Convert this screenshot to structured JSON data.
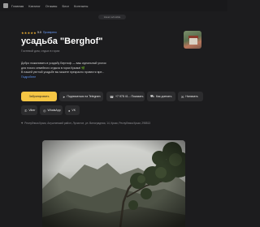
{
  "nav": {
    "links": [
      "Главная",
      "Каталог",
      "Отзывы",
      "Блог",
      "Контакты"
    ]
  },
  "domain_badge": "travel.ru/mobile",
  "profile": {
    "stars": "★★★★★",
    "rating": "5.0",
    "verified_label": "Проверено",
    "title": "усадьба \"Berghof\"",
    "category": "Гостевой дом, отдых в горах"
  },
  "description": {
    "lines": [
      "Добро пожаловать в усадьбу Бергхоф — ваш идеальный уголок",
      "для тихого семейного отдыха в горах Крыма! 🌿",
      "В нашей уютной усадьбе вы можете прекрасно провести вре..."
    ],
    "more_link": "Подробнее"
  },
  "actions": {
    "book": "Забронировать",
    "telegram": "Подписаться на Telegram",
    "phone": "+7 978 41... Показать",
    "route": "Как доехать",
    "write": "Написать",
    "viber": "Viber",
    "whatsapp": "WhatsApp",
    "vk": "VK"
  },
  "icons": {
    "telegram": "paper-plane-icon",
    "phone": "phone-icon",
    "route": "car-icon",
    "write": "message-icon",
    "viber": "viber-icon",
    "whatsapp": "whatsapp-icon",
    "vk": "vk-icon",
    "address": "map-pin-icon"
  },
  "address": "Республика Крым, Алуштинский район, Лучистое, ул. Виноградная, 14, Крым, Республика Крым, 298513",
  "colors": {
    "background": "#1c1c1e",
    "accent": "#f5c544",
    "star": "#f2b233",
    "link": "#5a8fea"
  }
}
